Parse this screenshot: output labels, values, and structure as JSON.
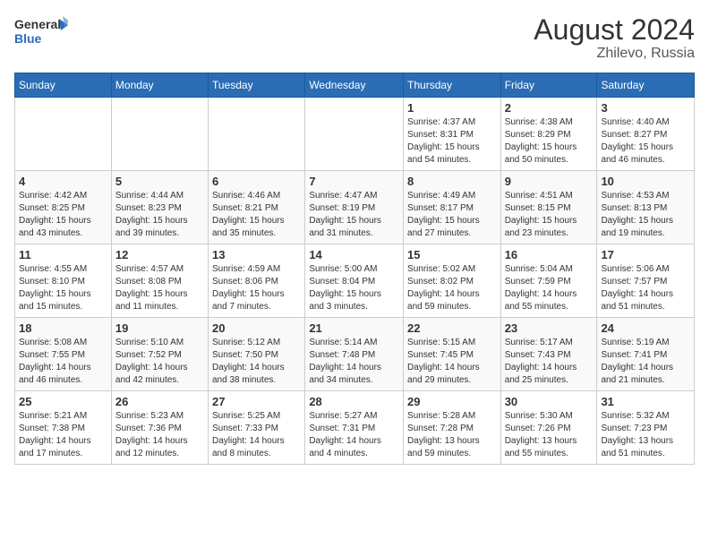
{
  "header": {
    "logo_general": "General",
    "logo_blue": "Blue",
    "month_year": "August 2024",
    "location": "Zhilevo, Russia"
  },
  "days_of_week": [
    "Sunday",
    "Monday",
    "Tuesday",
    "Wednesday",
    "Thursday",
    "Friday",
    "Saturday"
  ],
  "weeks": [
    [
      {
        "day": "",
        "info": ""
      },
      {
        "day": "",
        "info": ""
      },
      {
        "day": "",
        "info": ""
      },
      {
        "day": "",
        "info": ""
      },
      {
        "day": "1",
        "info": "Sunrise: 4:37 AM\nSunset: 8:31 PM\nDaylight: 15 hours\nand 54 minutes."
      },
      {
        "day": "2",
        "info": "Sunrise: 4:38 AM\nSunset: 8:29 PM\nDaylight: 15 hours\nand 50 minutes."
      },
      {
        "day": "3",
        "info": "Sunrise: 4:40 AM\nSunset: 8:27 PM\nDaylight: 15 hours\nand 46 minutes."
      }
    ],
    [
      {
        "day": "4",
        "info": "Sunrise: 4:42 AM\nSunset: 8:25 PM\nDaylight: 15 hours\nand 43 minutes."
      },
      {
        "day": "5",
        "info": "Sunrise: 4:44 AM\nSunset: 8:23 PM\nDaylight: 15 hours\nand 39 minutes."
      },
      {
        "day": "6",
        "info": "Sunrise: 4:46 AM\nSunset: 8:21 PM\nDaylight: 15 hours\nand 35 minutes."
      },
      {
        "day": "7",
        "info": "Sunrise: 4:47 AM\nSunset: 8:19 PM\nDaylight: 15 hours\nand 31 minutes."
      },
      {
        "day": "8",
        "info": "Sunrise: 4:49 AM\nSunset: 8:17 PM\nDaylight: 15 hours\nand 27 minutes."
      },
      {
        "day": "9",
        "info": "Sunrise: 4:51 AM\nSunset: 8:15 PM\nDaylight: 15 hours\nand 23 minutes."
      },
      {
        "day": "10",
        "info": "Sunrise: 4:53 AM\nSunset: 8:13 PM\nDaylight: 15 hours\nand 19 minutes."
      }
    ],
    [
      {
        "day": "11",
        "info": "Sunrise: 4:55 AM\nSunset: 8:10 PM\nDaylight: 15 hours\nand 15 minutes."
      },
      {
        "day": "12",
        "info": "Sunrise: 4:57 AM\nSunset: 8:08 PM\nDaylight: 15 hours\nand 11 minutes."
      },
      {
        "day": "13",
        "info": "Sunrise: 4:59 AM\nSunset: 8:06 PM\nDaylight: 15 hours\nand 7 minutes."
      },
      {
        "day": "14",
        "info": "Sunrise: 5:00 AM\nSunset: 8:04 PM\nDaylight: 15 hours\nand 3 minutes."
      },
      {
        "day": "15",
        "info": "Sunrise: 5:02 AM\nSunset: 8:02 PM\nDaylight: 14 hours\nand 59 minutes."
      },
      {
        "day": "16",
        "info": "Sunrise: 5:04 AM\nSunset: 7:59 PM\nDaylight: 14 hours\nand 55 minutes."
      },
      {
        "day": "17",
        "info": "Sunrise: 5:06 AM\nSunset: 7:57 PM\nDaylight: 14 hours\nand 51 minutes."
      }
    ],
    [
      {
        "day": "18",
        "info": "Sunrise: 5:08 AM\nSunset: 7:55 PM\nDaylight: 14 hours\nand 46 minutes."
      },
      {
        "day": "19",
        "info": "Sunrise: 5:10 AM\nSunset: 7:52 PM\nDaylight: 14 hours\nand 42 minutes."
      },
      {
        "day": "20",
        "info": "Sunrise: 5:12 AM\nSunset: 7:50 PM\nDaylight: 14 hours\nand 38 minutes."
      },
      {
        "day": "21",
        "info": "Sunrise: 5:14 AM\nSunset: 7:48 PM\nDaylight: 14 hours\nand 34 minutes."
      },
      {
        "day": "22",
        "info": "Sunrise: 5:15 AM\nSunset: 7:45 PM\nDaylight: 14 hours\nand 29 minutes."
      },
      {
        "day": "23",
        "info": "Sunrise: 5:17 AM\nSunset: 7:43 PM\nDaylight: 14 hours\nand 25 minutes."
      },
      {
        "day": "24",
        "info": "Sunrise: 5:19 AM\nSunset: 7:41 PM\nDaylight: 14 hours\nand 21 minutes."
      }
    ],
    [
      {
        "day": "25",
        "info": "Sunrise: 5:21 AM\nSunset: 7:38 PM\nDaylight: 14 hours\nand 17 minutes."
      },
      {
        "day": "26",
        "info": "Sunrise: 5:23 AM\nSunset: 7:36 PM\nDaylight: 14 hours\nand 12 minutes."
      },
      {
        "day": "27",
        "info": "Sunrise: 5:25 AM\nSunset: 7:33 PM\nDaylight: 14 hours\nand 8 minutes."
      },
      {
        "day": "28",
        "info": "Sunrise: 5:27 AM\nSunset: 7:31 PM\nDaylight: 14 hours\nand 4 minutes."
      },
      {
        "day": "29",
        "info": "Sunrise: 5:28 AM\nSunset: 7:28 PM\nDaylight: 13 hours\nand 59 minutes."
      },
      {
        "day": "30",
        "info": "Sunrise: 5:30 AM\nSunset: 7:26 PM\nDaylight: 13 hours\nand 55 minutes."
      },
      {
        "day": "31",
        "info": "Sunrise: 5:32 AM\nSunset: 7:23 PM\nDaylight: 13 hours\nand 51 minutes."
      }
    ]
  ]
}
